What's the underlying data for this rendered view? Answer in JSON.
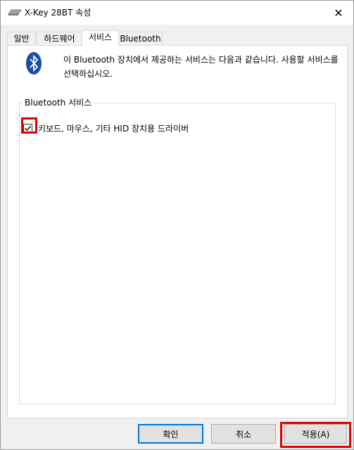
{
  "window": {
    "title": "X-Key 28BT 속성",
    "close_glyph": "✕"
  },
  "tabs": [
    {
      "label": "일반",
      "active": false
    },
    {
      "label": "하드웨어",
      "active": false
    },
    {
      "label": "서비스",
      "active": true
    },
    {
      "label": "Bluetooth",
      "active": false
    }
  ],
  "services_page": {
    "description": "이 Bluetooth 장치에서 제공하는 서비스는 다음과 같습니다. 사용할 서비스를 선택하십시오.",
    "group_title": "Bluetooth 서비스",
    "services": [
      {
        "label": "키보드, 마우스, 기타 HID 장치용 드라이버",
        "checked": true
      }
    ]
  },
  "buttons": {
    "ok": "확인",
    "cancel": "취소",
    "apply": "적용(A)"
  },
  "colors": {
    "bluetooth_blue": "#1a4ea8",
    "highlight_red": "#e00000",
    "default_button_border": "#0078d7"
  },
  "icons": {
    "title": "keyboard-icon",
    "bluetooth": "bluetooth-logo-icon",
    "check": "checkmark-icon"
  }
}
